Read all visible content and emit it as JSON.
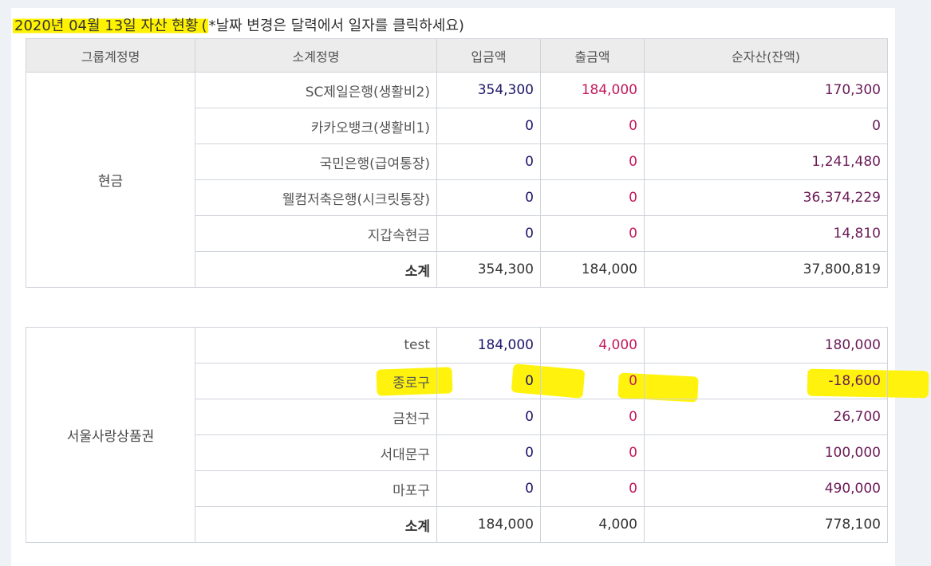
{
  "title": {
    "date_part": "2020년 04월 13일 자산 현황",
    "hint": "(*날짜 변경은 달력에서 일자를 클릭하세요)"
  },
  "headers": [
    "그룹계정명",
    "소계정명",
    "입금액",
    "출금액",
    "순자산(잔액)"
  ],
  "groups": [
    {
      "name": "현금",
      "rows": [
        {
          "name": "SC제일은행(생활비2)",
          "in": "354,300",
          "out": "184,000",
          "net": "170,300"
        },
        {
          "name": "카카오뱅크(생활비1)",
          "in": "0",
          "out": "0",
          "net": "0"
        },
        {
          "name": "국민은행(급여통장)",
          "in": "0",
          "out": "0",
          "net": "1,241,480"
        },
        {
          "name": "웰컴저축은행(시크릿통장)",
          "in": "0",
          "out": "0",
          "net": "36,374,229"
        },
        {
          "name": "지갑속현금",
          "in": "0",
          "out": "0",
          "net": "14,810"
        }
      ],
      "subtotal": {
        "label": "소계",
        "in": "354,300",
        "out": "184,000",
        "net": "37,800,819"
      }
    },
    {
      "name": "서울사랑상품권",
      "rows": [
        {
          "name": "test",
          "in": "184,000",
          "out": "4,000",
          "net": "180,000"
        },
        {
          "name": "종로구",
          "in": "0",
          "out": "0",
          "net": "-18,600"
        },
        {
          "name": "금천구",
          "in": "0",
          "out": "0",
          "net": "26,700"
        },
        {
          "name": "서대문구",
          "in": "0",
          "out": "0",
          "net": "100,000"
        },
        {
          "name": "마포구",
          "in": "0",
          "out": "0",
          "net": "490,000"
        }
      ],
      "subtotal": {
        "label": "소계",
        "in": "184,000",
        "out": "4,000",
        "net": "778,100"
      }
    }
  ],
  "colors": {
    "highlight": "#fff200",
    "deposit": "#1c1468",
    "withdraw": "#c2185b",
    "net": "#6a1a57",
    "header_bg": "#ececec"
  }
}
